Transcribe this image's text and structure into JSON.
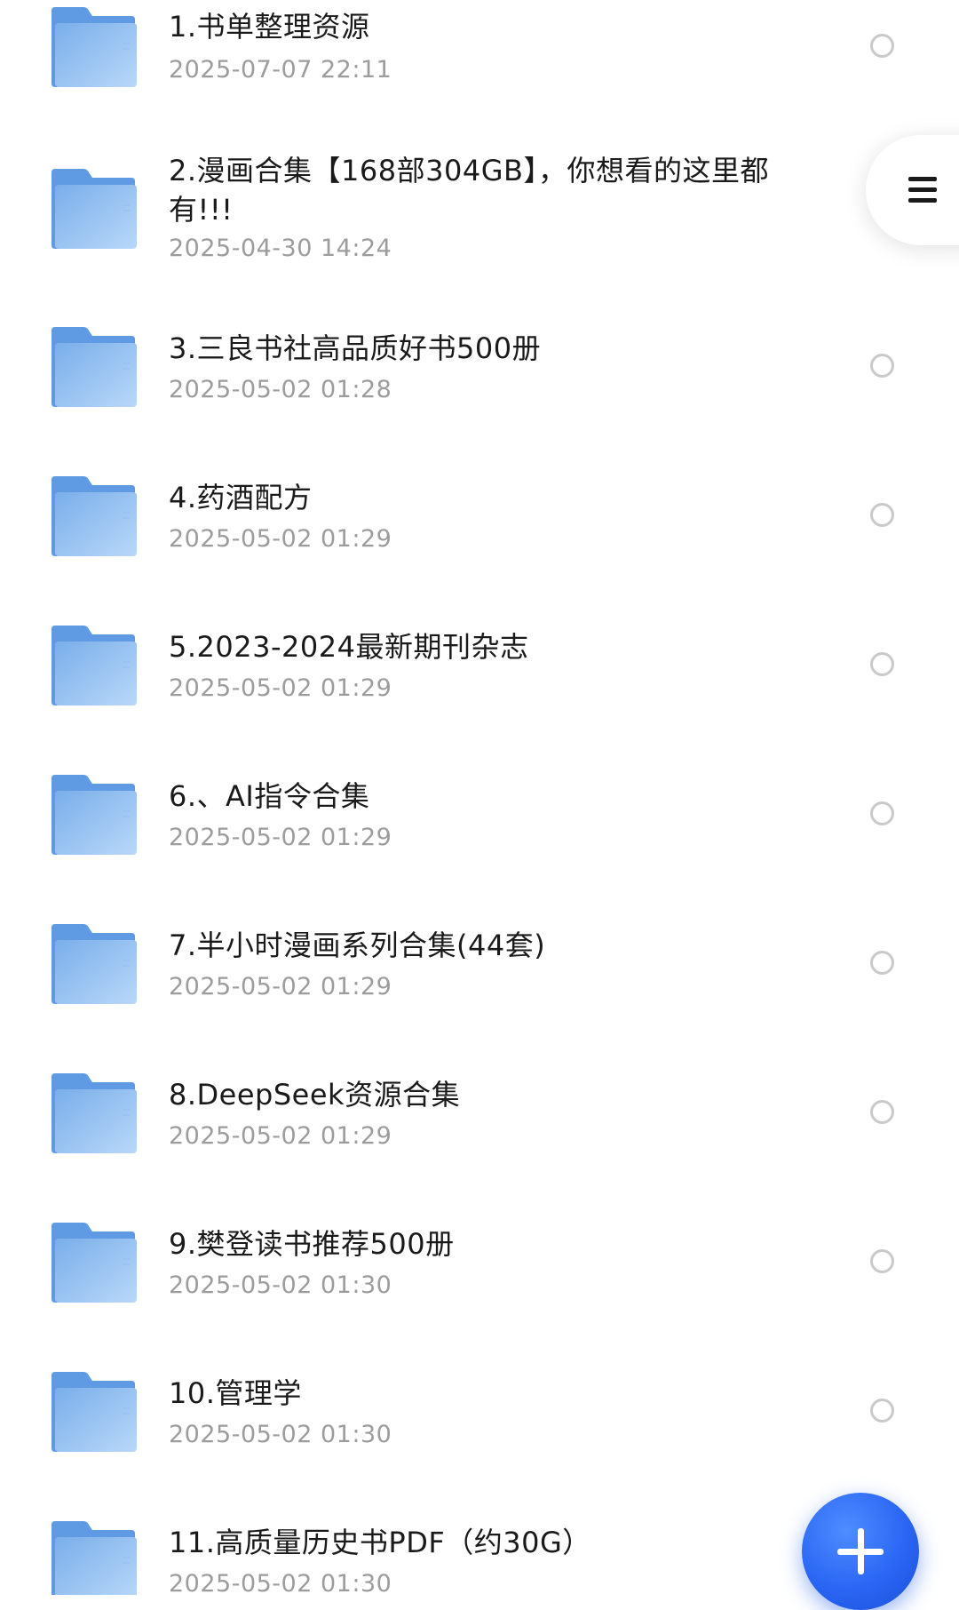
{
  "files": [
    {
      "name": "1.书单整理资源",
      "date": "2025-07-07 22:11",
      "icon": "folder-icon"
    },
    {
      "name": "2.漫画合集【168部304GB】，你想看的这里都有!!!",
      "date": "2025-04-30 14:24",
      "icon": "folder-icon"
    },
    {
      "name": "3.三良书社高品质好书500册",
      "date": "2025-05-02 01:28",
      "icon": "folder-icon"
    },
    {
      "name": "4.药酒配方",
      "date": "2025-05-02 01:29",
      "icon": "folder-icon"
    },
    {
      "name": "5.2023-2024最新期刊杂志",
      "date": "2025-05-02 01:29",
      "icon": "folder-icon"
    },
    {
      "name": "6.、AI指令合集",
      "date": "2025-05-02 01:29",
      "icon": "folder-icon"
    },
    {
      "name": "7.半小时漫画系列合集(44套)",
      "date": "2025-05-02 01:29",
      "icon": "folder-icon"
    },
    {
      "name": "8.DeepSeek资源合集",
      "date": "2025-05-02 01:29",
      "icon": "folder-icon"
    },
    {
      "name": "9.樊登读书推荐500册",
      "date": "2025-05-02 01:30",
      "icon": "folder-icon"
    },
    {
      "name": "10.管理学",
      "date": "2025-05-02 01:30",
      "icon": "folder-icon"
    },
    {
      "name": "11.高质量历史书PDF（约30G）",
      "date": "2025-05-02 01:30",
      "icon": "folder-icon"
    }
  ],
  "controls": {
    "menu_icon": "hamburger-menu-icon",
    "fab_icon": "plus-icon"
  },
  "colors": {
    "folder": "#7fb2ee",
    "accent": "#2a66f4",
    "date_text": "#9c9c9c",
    "title_text": "#1a1a1a"
  }
}
